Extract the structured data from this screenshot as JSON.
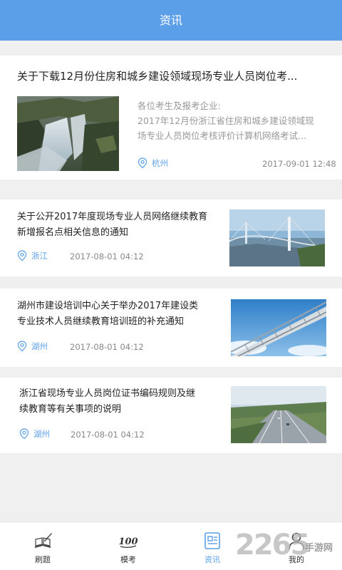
{
  "header": {
    "title": "资讯"
  },
  "articles": [
    {
      "title": "关于下载12月份住房和城乡建设领域现场专业人员岗位考...",
      "desc_lines": [
        "各位考生及报考企业:",
        "2017年12月份浙江省住房和城乡建设领域现",
        "场专业人员岗位考核评价计算机网络考试..."
      ],
      "location": "杭州",
      "date": "2017-09-01  12:48",
      "thumb": "waterfall-photo"
    },
    {
      "title_lines": [
        "关于公开2017年度现场专业人员网络继续教育",
        "新增报名点相关信息的通知"
      ],
      "location": "浙江",
      "date": "2017-08-01   04:12",
      "thumb": "bridge-photo"
    },
    {
      "title_lines": [
        "湖州市建设培训中心关于举办2017年建设类",
        "专业技术人员继续教育培训班的补充通知"
      ],
      "location": "湖州",
      "date": "2017-08-01   04:12",
      "thumb": "sky-bridge-photo"
    },
    {
      "title_lines": [
        "浙江省现场专业人员岗位证书编码规则及继",
        "续教育等有关事项的说明"
      ],
      "location": "湖州",
      "date": "2017-08-01   04:12",
      "thumb": "highway-photo"
    }
  ],
  "tabbar": [
    {
      "label": "刷题",
      "icon": "book-pen-icon"
    },
    {
      "label": "模考",
      "icon": "score-100-icon",
      "icon_text": "100"
    },
    {
      "label": "资讯",
      "icon": "news-icon",
      "active": true
    },
    {
      "label": "我的",
      "icon": "person-icon"
    }
  ],
  "watermark": {
    "number": "2265",
    "text": "手游网"
  },
  "colors": {
    "primary": "#5b9fe8",
    "background": "#f0f0f0"
  }
}
